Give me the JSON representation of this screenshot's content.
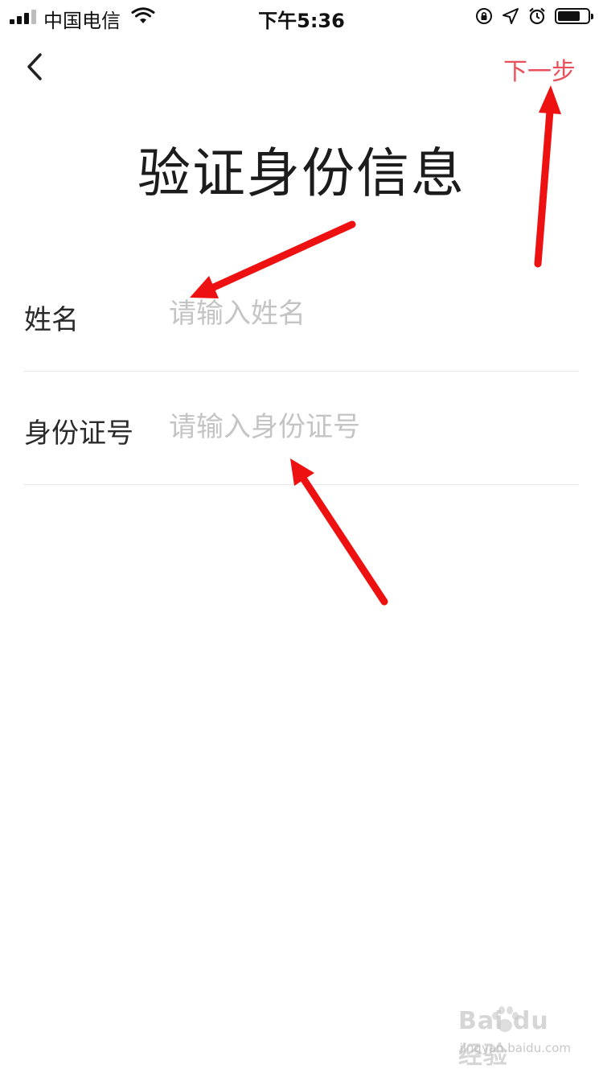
{
  "status_bar": {
    "carrier": "中国电信",
    "time": "下午5:36",
    "battery_level": 0.75
  },
  "nav": {
    "back_icon": "chevron-left-icon",
    "next_label": "下一步"
  },
  "title": "验证身份信息",
  "form": {
    "name": {
      "label": "姓名",
      "value": "",
      "placeholder": "请输入姓名"
    },
    "id_number": {
      "label": "身份证号",
      "value": "",
      "placeholder": "请输入身份证号"
    }
  },
  "colors": {
    "accent": "#e8505b",
    "annotation": "#ee1111",
    "placeholder": "#c4c4c4"
  },
  "watermark": {
    "brand": "Bai du 经验",
    "url": "jingyan.baidu.com"
  }
}
